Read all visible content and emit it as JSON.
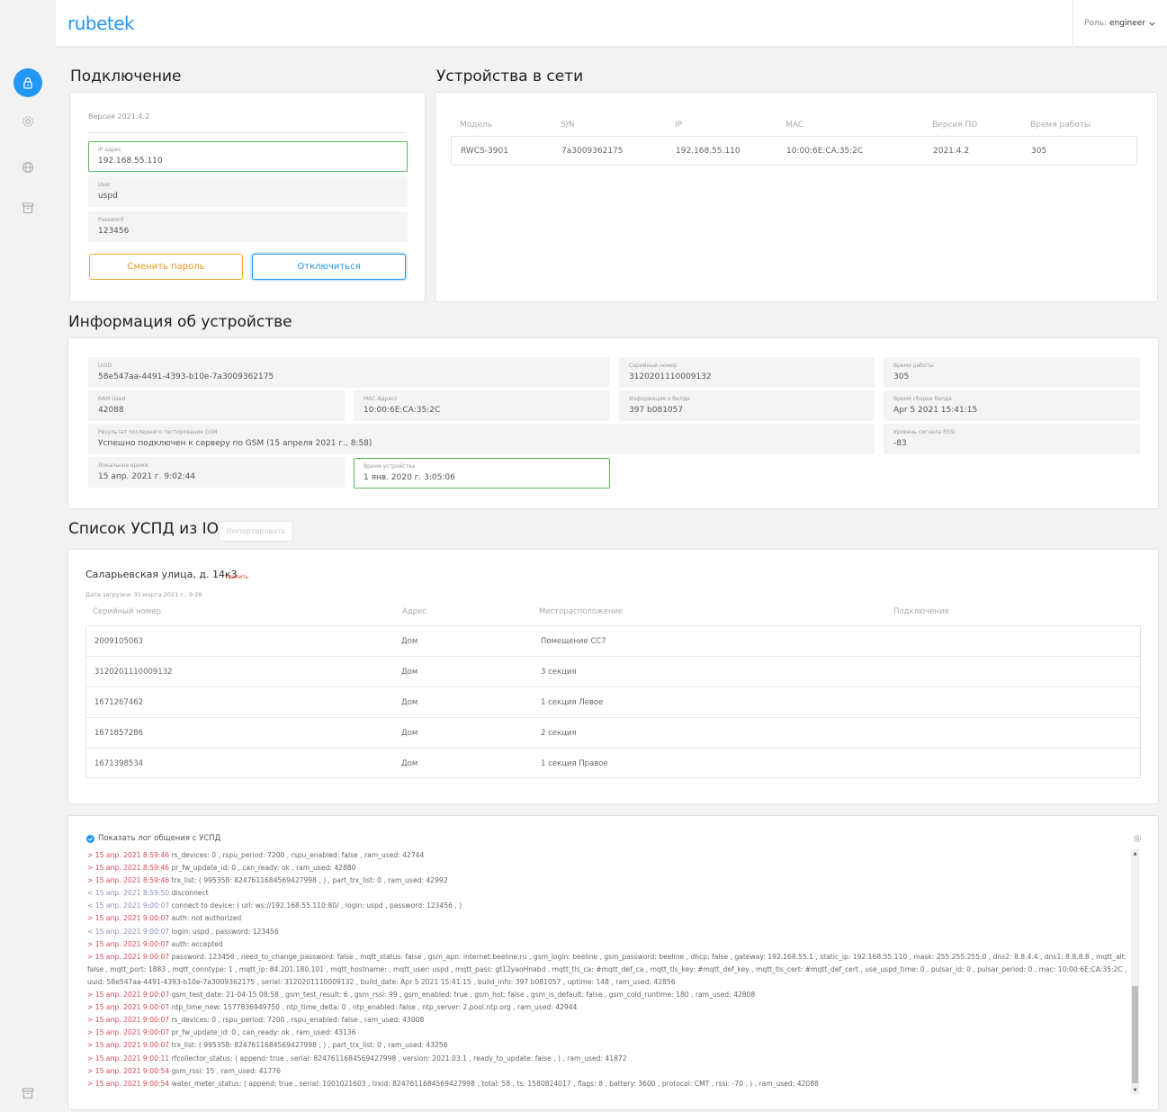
{
  "app": {
    "logo": "rubetek",
    "role_label": "Роль:",
    "role_value": "engineer"
  },
  "connection": {
    "title": "Подключение",
    "version": "Версия 2021.4.2",
    "ip_label": "IP адрес",
    "ip_value": "192.168.55.110",
    "user_label": "User",
    "user_value": "uspd",
    "password_label": "Password",
    "password_value": "123456",
    "change_password": "Сменить пароль",
    "disconnect": "Отключиться"
  },
  "network_devices": {
    "title": "Устройства в сети",
    "columns": [
      "Модель",
      "S/N",
      "IP",
      "MAC",
      "Версия ПО",
      "Время работы"
    ],
    "rows": [
      [
        "RWCS-3901",
        "7a3009362175",
        "192.168.55.110",
        "10:00:6E:CA:35:2C",
        "2021.4.2",
        "305"
      ]
    ]
  },
  "device_info": {
    "title": "Информация об устройстве",
    "fields": {
      "uuid": {
        "label": "UUID",
        "value": "58e547aa-4491-4393-b10e-7a3009362175"
      },
      "serial": {
        "label": "Серийный номер",
        "value": "3120201110009132"
      },
      "uptime": {
        "label": "Время работы",
        "value": "305"
      },
      "ram": {
        "label": "RAM Used",
        "value": "42088"
      },
      "mac": {
        "label": "MAC-Адресс",
        "value": "10:00:6E:CA:35:2C"
      },
      "build_info": {
        "label": "Информация о билде",
        "value": "397 b081057"
      },
      "build_time": {
        "label": "Время сборки билда",
        "value": "Apr  5 2021 15:41:15"
      },
      "gsm_result": {
        "label": "Результат последнего тестирования GSM",
        "value": "Успешно подключен к серверу по GSM (15 апреля 2021 г., 8:58)"
      },
      "rssi": {
        "label": "Уровень сигнала RSSI",
        "value": "-83"
      },
      "local_time": {
        "label": "Локальное время",
        "value": "15 апр. 2021 г. 9:02:44"
      },
      "device_time": {
        "label": "Время устройства",
        "value": "1 янв. 2020 г. 3:05:06"
      }
    }
  },
  "uspd_list": {
    "title": "Список УСПД из IOT",
    "import_button": "Импортировать",
    "address": "Саларьевская улица, д. 14к3",
    "delete": "Удалить",
    "upload_date": "Дата загрузки: 31 марта 2021 г., 9:26",
    "columns": [
      "Серийный номер",
      "Адрес",
      "Месторасположение",
      "Подключение"
    ],
    "rows": [
      [
        "2009105063",
        "Дом",
        "Помещение СС7",
        ""
      ],
      [
        "3120201110009132",
        "Дом",
        "3 секция",
        ""
      ],
      [
        "1671267462",
        "Дом",
        "1 секция Левое",
        ""
      ],
      [
        "1671857286",
        "Дом",
        "2 секция",
        ""
      ],
      [
        "1671398534",
        "Дом",
        "1 секция Правое",
        ""
      ]
    ]
  },
  "log": {
    "show_label": "Показать лог общения с УСПД",
    "lines": [
      {
        "dir": "out",
        "ts": "> 15 апр. 2021 8:59:46",
        "text": "rs_devices: 0 , rspu_period: 7200 , rspu_enabled: false , ram_used: 42744"
      },
      {
        "dir": "out",
        "ts": "> 15 апр. 2021 8:59:46",
        "text": "pr_fw_update_id: 0 , can_ready: ok , ram_used: 42880"
      },
      {
        "dir": "out",
        "ts": "> 15 апр. 2021 8:59:46",
        "text": "trx_list: ( 995358: 8247611684569427998 , ) , part_trx_list: 0 , ram_used: 42992"
      },
      {
        "dir": "in",
        "ts": "< 15 апр. 2021 8:59:50",
        "text": "disconnect"
      },
      {
        "dir": "in",
        "ts": "< 15 апр. 2021 9:00:07",
        "text": "connect to device: ( url: ws://192.168.55.110:80/ , login: uspd , password: 123456 , )"
      },
      {
        "dir": "out",
        "ts": "> 15 апр. 2021 9:00:07",
        "text": "auth: not authorized"
      },
      {
        "dir": "in",
        "ts": "< 15 апр. 2021 9:00:07",
        "text": "login: uspd , password: 123456"
      },
      {
        "dir": "out",
        "ts": "> 15 апр. 2021 9:00:07",
        "text": "auth: accepted"
      },
      {
        "dir": "out",
        "ts": "> 15 апр. 2021 9:00:07",
        "wrap": true,
        "text": "password: 123456 , need_to_change_password: false , mqtt_status: false , gsm_apn: internet.beeline.ru , gsm_login: beeline , gsm_password: beeline , dhcp: false , gateway: 192.168.55.1 , static_ip: 192.168.55.110 , mask: 255.255.255.0 , dns2: 8.8.4.4 , dns1: 8.8.8.8 , mqtt_alt: false , mqtt_port: 1883 , mqtt_conntype: 1 , mqtt_ip: 84.201.180.101 , mqtt_hostname: , mqtt_user: uspd , mqtt_pass: gt12yaoHnabd , mqtt_tls_ca: #mqtt_def_ca , mqtt_tls_key: #mqtt_def_key , mqtt_tls_cert: #mqtt_def_cert , use_uspd_time: 0 , pulsar_id: 0 , pulsar_period: 0 , mac: 10:00:6E:CA:35:2C , uuid: 58e547aa-4491-4393-b10e-7a3009362175 , serial: 3120201110009132 , build_date: Apr 5 2021 15:41:15 , build_info: 397 b081057 , uptime: 148 , ram_used: 42856"
      },
      {
        "dir": "out",
        "ts": "> 15 апр. 2021 9:00:07",
        "text": "gsm_test_date: 21-04-15 08:58 , gsm_test_result: 6 , gsm_rssi: 99 , gsm_enabled: true , gsm_hot: false , gsm_is_default: false , gsm_cold_runtime: 180 , ram_used: 42808"
      },
      {
        "dir": "out",
        "ts": "> 15 апр. 2021 9:00:07",
        "text": "ntp_time_new: 1577836949750 , ntp_time_delta: 0 , ntp_enabled: false , ntp_server: 2.pool.ntp.org , ram_used: 42944"
      },
      {
        "dir": "out",
        "ts": "> 15 апр. 2021 9:00:07",
        "text": "rs_devices: 0 , rspu_period: 7200 , rspu_enabled: false , ram_used: 43008"
      },
      {
        "dir": "out",
        "ts": "> 15 апр. 2021 9:00:07",
        "text": "pr_fw_update_id: 0 , can_ready: ok , ram_used: 43136"
      },
      {
        "dir": "out",
        "ts": "> 15 апр. 2021 9:00:07",
        "text": "trx_list: ( 995358: 8247611684569427998 , ) , part_trx_list: 0 , ram_used: 43256"
      },
      {
        "dir": "out",
        "ts": "> 15 апр. 2021 9:00:11",
        "text": "rfcollector_status: ( append: true , serial: 8247611684569427998 , version: 2021.03.1 , ready_to_update: false , ) , ram_used: 41872"
      },
      {
        "dir": "out",
        "ts": "> 15 апр. 2021 9:00:54",
        "text": "gsm_rssi: 15 , ram_used: 41776"
      },
      {
        "dir": "out",
        "ts": "> 15 апр. 2021 9:00:54",
        "text": "water_meter_status: ( append: true , serial: 1001021603 , trxid: 8247611684569427998 , total: 58 , ts: 1580824017 , flags: 8 , battery: 3600 , protocol: CMT , rssi: -70 , ) , ram_used: 42088"
      }
    ]
  }
}
